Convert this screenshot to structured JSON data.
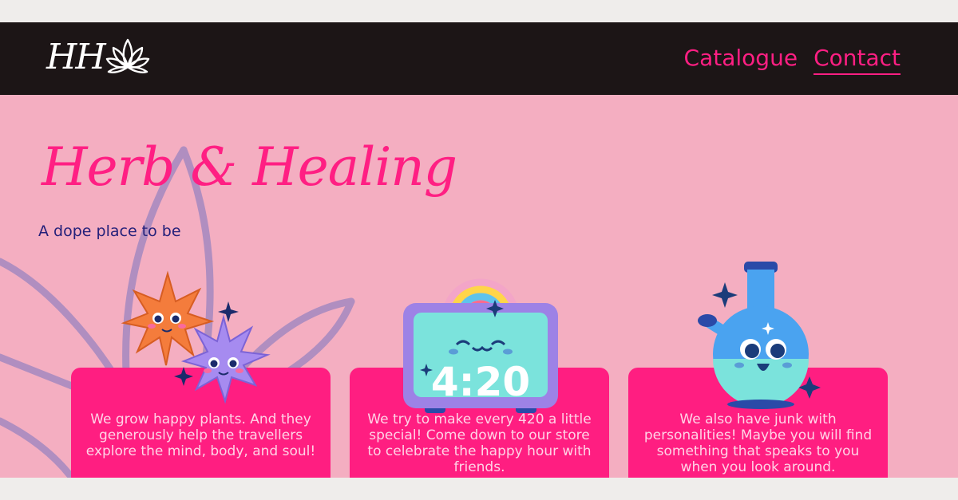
{
  "brand": {
    "logo_text": "HH",
    "logo_icon": "lotus-icon"
  },
  "nav": {
    "links": [
      {
        "label": "Catalogue",
        "active": false
      },
      {
        "label": "Contact",
        "active": true
      }
    ]
  },
  "hero": {
    "title": "Herb & Healing",
    "tagline": "A dope place to be"
  },
  "clock_display": "4:20",
  "cards": [
    {
      "illustration": "leaf-characters-illustration",
      "text": "We grow happy plants. And they generously help the travellers explore the mind, body, and soul!"
    },
    {
      "illustration": "rainbow-clock-illustration",
      "text": "We try to make every 420 a little special! Come down to our store to celebrate the happy hour with friends."
    },
    {
      "illustration": "bong-character-illustration",
      "text": "We also have junk with personalities! Maybe you will find something that speaks to you when you look around."
    }
  ],
  "colors": {
    "nav_bg": "#1c1516",
    "page_bg": "#f4aec1",
    "accent_pink": "#ff1f83",
    "tagline_navy": "#24207a",
    "card_text": "#ffd3e6"
  }
}
